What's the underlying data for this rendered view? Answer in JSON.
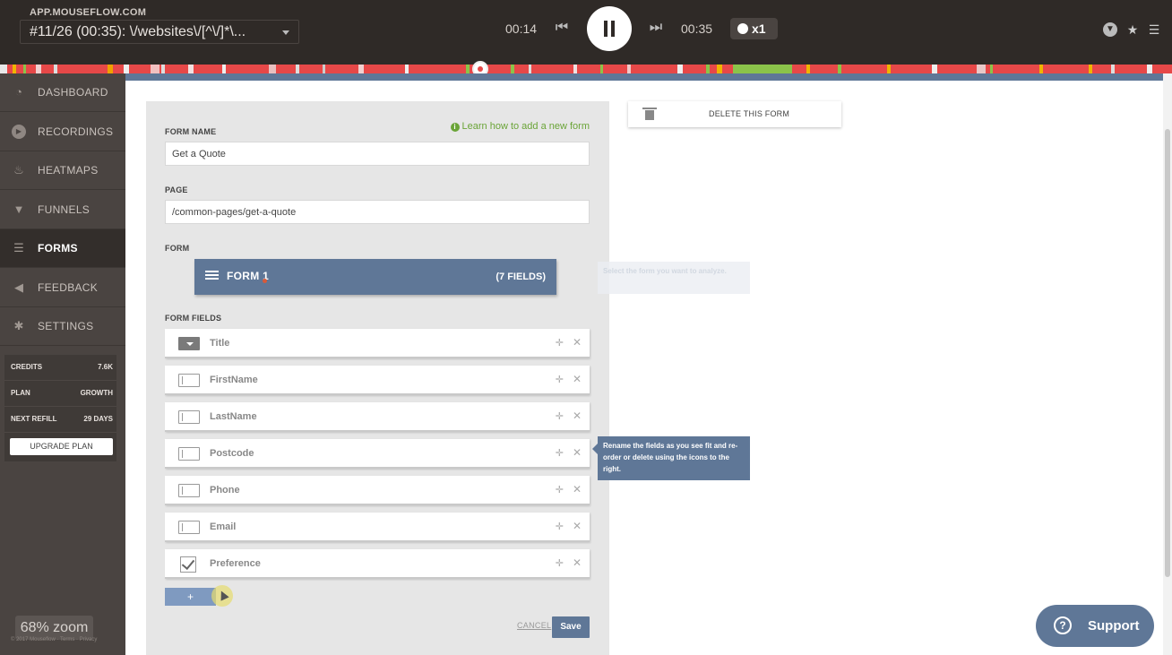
{
  "player": {
    "site": "APP.MOUSEFLOW.COM",
    "recording": "#11/26 (00:35): \\/websites\\/[^\\/]*\\...",
    "current_time": "00:14",
    "total_time": "00:35",
    "speed": "x1",
    "progress": 0.41
  },
  "sidebar": {
    "items": [
      {
        "label": "DASHBOARD",
        "icon": "dashboard-icon"
      },
      {
        "label": "RECORDINGS",
        "icon": "play-circle-icon"
      },
      {
        "label": "HEATMAPS",
        "icon": "flame-icon"
      },
      {
        "label": "FUNNELS",
        "icon": "funnel-icon"
      },
      {
        "label": "FORMS",
        "icon": "list-icon"
      },
      {
        "label": "FEEDBACK",
        "icon": "megaphone-icon"
      },
      {
        "label": "SETTINGS",
        "icon": "gear-icon"
      }
    ],
    "active": "FORMS",
    "credits": [
      {
        "key": "CREDITS",
        "value": "7.6K"
      },
      {
        "key": "PLAN",
        "value": "GROWTH"
      },
      {
        "key": "NEXT REFILL",
        "value": "29 DAYS"
      }
    ],
    "upgrade_label": "UPGRADE PLAN",
    "zoom": "68% zoom",
    "footer": "© 2017 Mouseflow · Terms · Privacy"
  },
  "form": {
    "learn_link": "Learn how to add a new form",
    "name_label": "FORM NAME",
    "name_value": "Get a Quote",
    "page_label": "PAGE",
    "page_value": "/common-pages/get-a-quote",
    "form_label": "FORM",
    "form_name": "FORM 1",
    "form_count": "(7 FIELDS)",
    "fields_label": "FORM FIELDS",
    "fields": [
      {
        "name": "Title",
        "type": "select"
      },
      {
        "name": "FirstName",
        "type": "text"
      },
      {
        "name": "LastName",
        "type": "text"
      },
      {
        "name": "Postcode",
        "type": "text"
      },
      {
        "name": "Phone",
        "type": "text"
      },
      {
        "name": "Email",
        "type": "text"
      },
      {
        "name": "Preference",
        "type": "checkbox"
      }
    ],
    "add_label": "+",
    "cancel_label": "CANCEL",
    "save_label": "Save"
  },
  "delete_label": "DELETE THIS FORM",
  "tips": {
    "select_form": "Select the form you want to analyze.",
    "rename_fields": "Rename the fields as you see fit and re-order or delete using the icons to the right."
  },
  "support_label": "Support",
  "colors": {
    "accent": "#5f7797",
    "topbar": "#2f2a27",
    "sidebar": "#4a4441",
    "timeline": "#e64848",
    "link_green": "#6aa437"
  }
}
